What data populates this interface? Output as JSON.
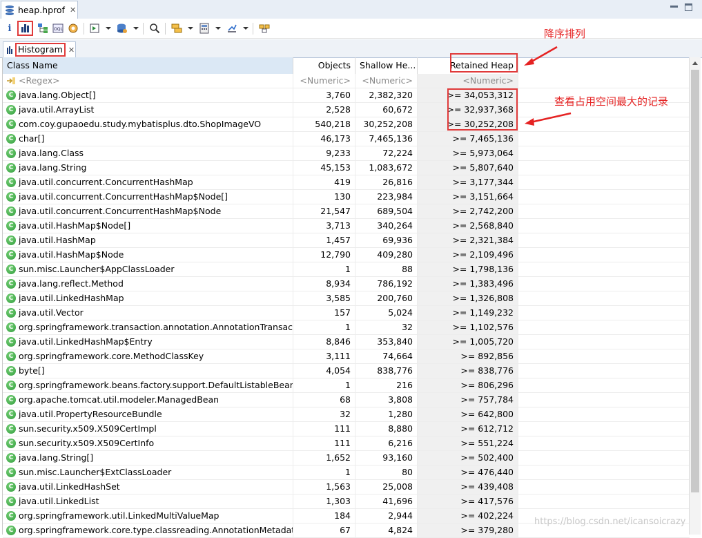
{
  "editor_tab": {
    "title": "heap.hprof"
  },
  "view_tab": {
    "label": "Histogram"
  },
  "columns": [
    "Class Name",
    "Objects",
    "Shallow He...",
    "Retained Heap"
  ],
  "filter_row": [
    "<Regex>",
    "<Numeric>",
    "<Numeric>",
    "<Numeric>"
  ],
  "rows": [
    {
      "name": "java.lang.Object[]",
      "objects": "3,760",
      "shallow": "2,382,320",
      "retained": ">= 34,053,312"
    },
    {
      "name": "java.util.ArrayList",
      "objects": "2,528",
      "shallow": "60,672",
      "retained": ">= 32,937,368"
    },
    {
      "name": "com.coy.gupaoedu.study.mybatisplus.dto.ShopImageVO",
      "objects": "540,218",
      "shallow": "30,252,208",
      "retained": ">= 30,252,208"
    },
    {
      "name": "char[]",
      "objects": "46,173",
      "shallow": "7,465,136",
      "retained": ">= 7,465,136"
    },
    {
      "name": "java.lang.Class",
      "objects": "9,233",
      "shallow": "72,224",
      "retained": ">= 5,973,064"
    },
    {
      "name": "java.lang.String",
      "objects": "45,153",
      "shallow": "1,083,672",
      "retained": ">= 5,807,640"
    },
    {
      "name": "java.util.concurrent.ConcurrentHashMap",
      "objects": "419",
      "shallow": "26,816",
      "retained": ">= 3,177,344"
    },
    {
      "name": "java.util.concurrent.ConcurrentHashMap$Node[]",
      "objects": "130",
      "shallow": "223,984",
      "retained": ">= 3,151,664"
    },
    {
      "name": "java.util.concurrent.ConcurrentHashMap$Node",
      "objects": "21,547",
      "shallow": "689,504",
      "retained": ">= 2,742,200"
    },
    {
      "name": "java.util.HashMap$Node[]",
      "objects": "3,713",
      "shallow": "340,264",
      "retained": ">= 2,568,840"
    },
    {
      "name": "java.util.HashMap",
      "objects": "1,457",
      "shallow": "69,936",
      "retained": ">= 2,321,384"
    },
    {
      "name": "java.util.HashMap$Node",
      "objects": "12,790",
      "shallow": "409,280",
      "retained": ">= 2,109,496"
    },
    {
      "name": "sun.misc.Launcher$AppClassLoader",
      "objects": "1",
      "shallow": "88",
      "retained": ">= 1,798,136"
    },
    {
      "name": "java.lang.reflect.Method",
      "objects": "8,934",
      "shallow": "786,192",
      "retained": ">= 1,383,496"
    },
    {
      "name": "java.util.LinkedHashMap",
      "objects": "3,585",
      "shallow": "200,760",
      "retained": ">= 1,326,808"
    },
    {
      "name": "java.util.Vector",
      "objects": "157",
      "shallow": "5,024",
      "retained": ">= 1,149,232"
    },
    {
      "name": "org.springframework.transaction.annotation.AnnotationTransactio...",
      "objects": "1",
      "shallow": "32",
      "retained": ">= 1,102,576"
    },
    {
      "name": "java.util.LinkedHashMap$Entry",
      "objects": "8,846",
      "shallow": "353,840",
      "retained": ">= 1,005,720"
    },
    {
      "name": "org.springframework.core.MethodClassKey",
      "objects": "3,111",
      "shallow": "74,664",
      "retained": ">= 892,856"
    },
    {
      "name": "byte[]",
      "objects": "4,054",
      "shallow": "838,776",
      "retained": ">= 838,776"
    },
    {
      "name": "org.springframework.beans.factory.support.DefaultListableBeanFa...",
      "objects": "1",
      "shallow": "216",
      "retained": ">= 806,296"
    },
    {
      "name": "org.apache.tomcat.util.modeler.ManagedBean",
      "objects": "68",
      "shallow": "3,808",
      "retained": ">= 757,784"
    },
    {
      "name": "java.util.PropertyResourceBundle",
      "objects": "32",
      "shallow": "1,280",
      "retained": ">= 642,800"
    },
    {
      "name": "sun.security.x509.X509CertImpl",
      "objects": "111",
      "shallow": "8,880",
      "retained": ">= 612,712"
    },
    {
      "name": "sun.security.x509.X509CertInfo",
      "objects": "111",
      "shallow": "6,216",
      "retained": ">= 551,224"
    },
    {
      "name": "java.lang.String[]",
      "objects": "1,652",
      "shallow": "93,160",
      "retained": ">= 502,400"
    },
    {
      "name": "sun.misc.Launcher$ExtClassLoader",
      "objects": "1",
      "shallow": "80",
      "retained": ">= 476,440"
    },
    {
      "name": "java.util.LinkedHashSet",
      "objects": "1,563",
      "shallow": "25,008",
      "retained": ">= 439,408"
    },
    {
      "name": "java.util.LinkedList",
      "objects": "1,303",
      "shallow": "41,696",
      "retained": ">= 417,576"
    },
    {
      "name": "org.springframework.util.LinkedMultiValueMap",
      "objects": "184",
      "shallow": "2,944",
      "retained": ">= 402,224"
    },
    {
      "name": "org.springframework.core.type.classreading.AnnotationMetadata...",
      "objects": "67",
      "shallow": "4,824",
      "retained": ">= 379,280"
    }
  ],
  "annotations": {
    "sort_desc": "降序排列",
    "view_largest": "查看占用空间最大的记录"
  },
  "watermark": "https://blog.csdn.net/icansoicrazy",
  "accent_color": "#e03a3a"
}
